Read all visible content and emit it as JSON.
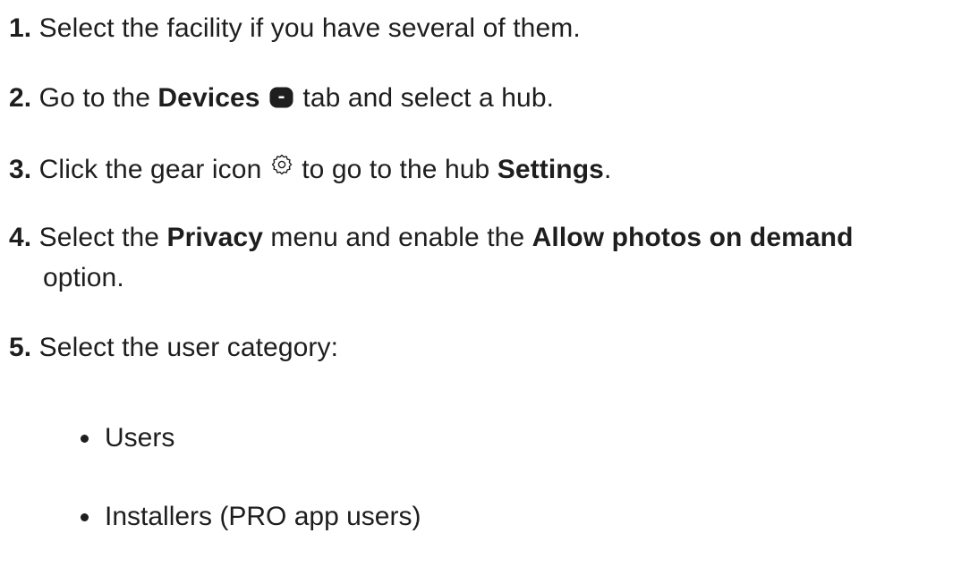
{
  "steps": [
    {
      "num": "1.",
      "text": " Select the facility if you have several of them."
    },
    {
      "num": "2.",
      "pre": " Go to the ",
      "bold": "Devices",
      "post": " tab and select a hub.",
      "icon": "devices-icon"
    },
    {
      "num": "3.",
      "pre": " Click the gear icon ",
      "post": " to go to the hub ",
      "bold": "Settings",
      "end": ".",
      "icon": "gear-icon"
    },
    {
      "num": "4.",
      "pre": " Select the ",
      "bold1": "Privacy",
      "mid": " menu and enable the ",
      "bold2": "Allow photos on demand",
      "line2": "option."
    },
    {
      "num": "5.",
      "text": " Select the user category:"
    }
  ],
  "categories": [
    "Users",
    "Installers (PRO app users)"
  ]
}
